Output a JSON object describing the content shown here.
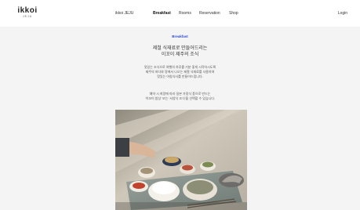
{
  "header": {
    "logo": {
      "main": "ikkoi",
      "sub": "JEJU"
    },
    "nav": [
      {
        "label": "ikkoi JEJU",
        "active": false
      },
      {
        "label": "Breakfast",
        "active": true
      },
      {
        "label": "Rooms",
        "active": false
      },
      {
        "label": "Reservation",
        "active": false
      },
      {
        "label": "Shop",
        "active": false
      }
    ],
    "login_label": "Login"
  },
  "main": {
    "section_label": "Breakfast",
    "headline": {
      "line1": "제철 식재료로 만들어드리는",
      "line2": "이꼬이 제주의 조식"
    },
    "description": {
      "line1": "맛있는 조식으로 여행의 하루를 기분 좋게 시작하시도록",
      "line2": "제주의 바다와 땅에서 나오는 제철 식재료를 사용하여",
      "line3": "맛있는 아침식사를 만들어드립니다."
    },
    "note": {
      "line1": "예약 시 희망에 따라 일본 가정식 풍으로 만드는",
      "line2": "'이꼬이 밥상' 또는 '서양식 조식'을 선택할 수 있습니다."
    }
  },
  "colors": {
    "accent": "#2f4bd6",
    "content_bg": "#f4f4f4"
  }
}
